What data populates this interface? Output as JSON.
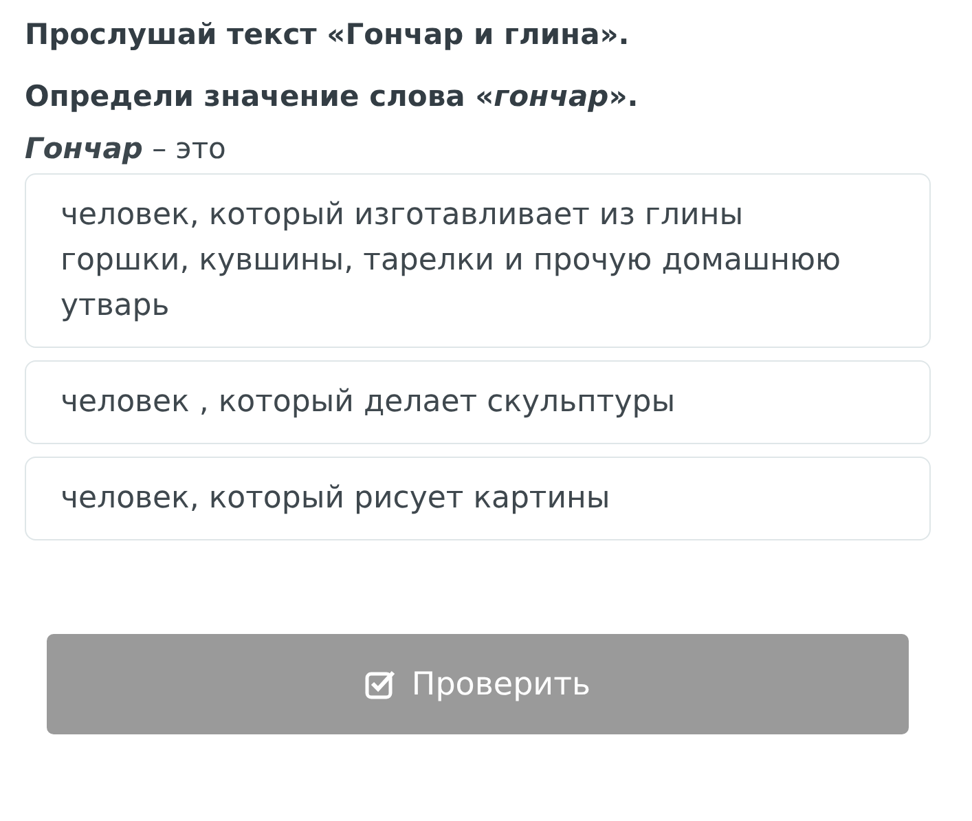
{
  "instructions": [
    "Прослушай текст «Гончар и глина».",
    "Определи значение слова «*гончар*»."
  ],
  "prompt": "**Гончар** – это",
  "options": [
    {
      "text": "человек, который изготавливает из глины горшки, кувшины, тарелки и прочую домашнюю утварь",
      "selected": false
    },
    {
      "text": "человек , который делает скульптуры",
      "selected": false
    },
    {
      "text": "человек, который рисует картины",
      "selected": false
    }
  ],
  "check_button": {
    "label": "Проверить",
    "disabled": true
  }
}
